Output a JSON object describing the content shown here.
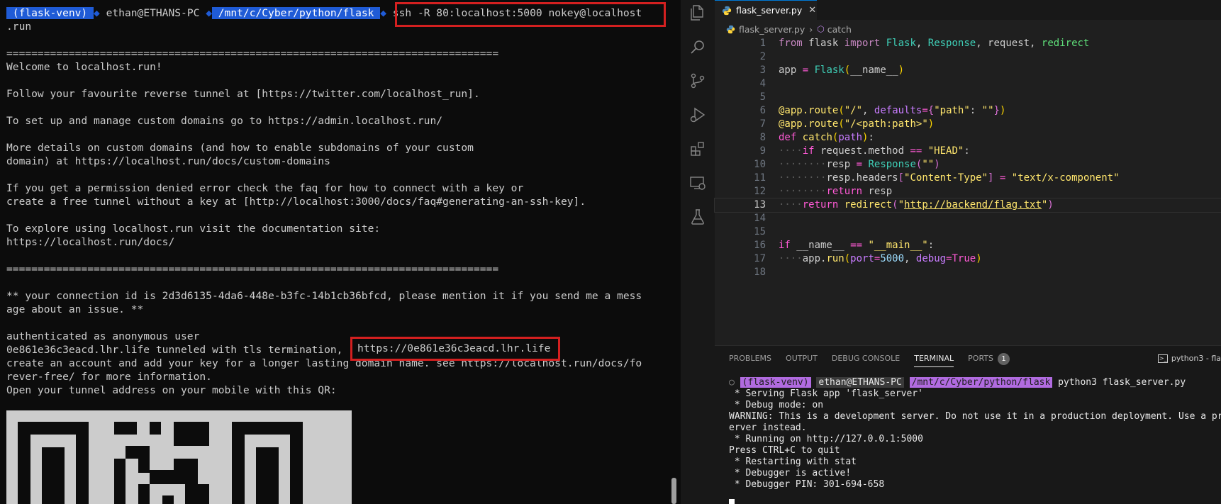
{
  "left_terminal": {
    "prompt": {
      "venv": " (flask-venv) ",
      "user": " ethan@ETHANS-PC ",
      "path": " /mnt/c/Cyber/python/flask ",
      "command": "ssh -R 80:localhost:5000 nokey@localhost"
    },
    "lines": [
      ".run",
      "",
      "===============================================================================",
      "Welcome to localhost.run!",
      "",
      "Follow your favourite reverse tunnel at [https://twitter.com/localhost_run].",
      "",
      "To set up and manage custom domains go to https://admin.localhost.run/",
      "",
      "More details on custom domains (and how to enable subdomains of your custom",
      "domain) at https://localhost.run/docs/custom-domains",
      "",
      "If you get a permission denied error check the faq for how to connect with a key or",
      "create a free tunnel without a key at [http://localhost:3000/docs/faq#generating-an-ssh-key].",
      "",
      "To explore using localhost.run visit the documentation site:",
      "https://localhost.run/docs/",
      "",
      "===============================================================================",
      "",
      "** your connection id is 2d3d6135-4da6-448e-b3fc-14b1cb36bfcd, please mention it if you send me a mess",
      "age about an issue. **",
      "",
      "authenticated as anonymous user",
      "0e861e36c3eacd.lhr.life tunneled with tls termination,",
      "create an account and add your key for a longer lasting domain name. see https://localhost.run/docs/fo",
      "rever-free/ for more information.",
      "Open your tunnel address on your mobile with this QR:"
    ],
    "tunnel_url": "https://0e861e36c3eacd.lhr.life"
  },
  "vscode": {
    "tab": {
      "label": "flask_server.py",
      "close": "✕"
    },
    "breadcrumb": {
      "file": "flask_server.py",
      "symbol": "catch"
    },
    "active_line": 13,
    "line_numbers": [
      "1",
      "2",
      "3",
      "4",
      "5",
      "6",
      "7",
      "8",
      "9",
      "10",
      "11",
      "12",
      "13",
      "14",
      "15",
      "16",
      "17",
      "18"
    ],
    "panel": {
      "tabs": [
        "PROBLEMS",
        "OUTPUT",
        "DEBUG CONSOLE",
        "TERMINAL",
        "PORTS"
      ],
      "active_tab": "TERMINAL",
      "ports_badge": "1",
      "terminal_name": "python3 - fla"
    },
    "terminal": {
      "prompt": {
        "venv": "(flask-venv)",
        "user": "ethan@ETHANS-PC",
        "path": "/mnt/c/Cyber/python/flask",
        "command": "python3 flask_server.py"
      },
      "lines": [
        " * Serving Flask app 'flask_server'",
        " * Debug mode: on",
        "WARNING: This is a development server. Do not use it in a production deployment. Use a production WSGI s",
        "erver instead.",
        " * Running on http://127.0.0.1:5000",
        "Press CTRL+C to quit",
        " * Restarting with stat",
        " * Debugger is active!",
        " * Debugger PIN: 301-694-658"
      ]
    },
    "colors": {
      "accent": "#0078d4",
      "prompt_purple": "#b16be0",
      "warning": "#ff5e6e"
    }
  }
}
